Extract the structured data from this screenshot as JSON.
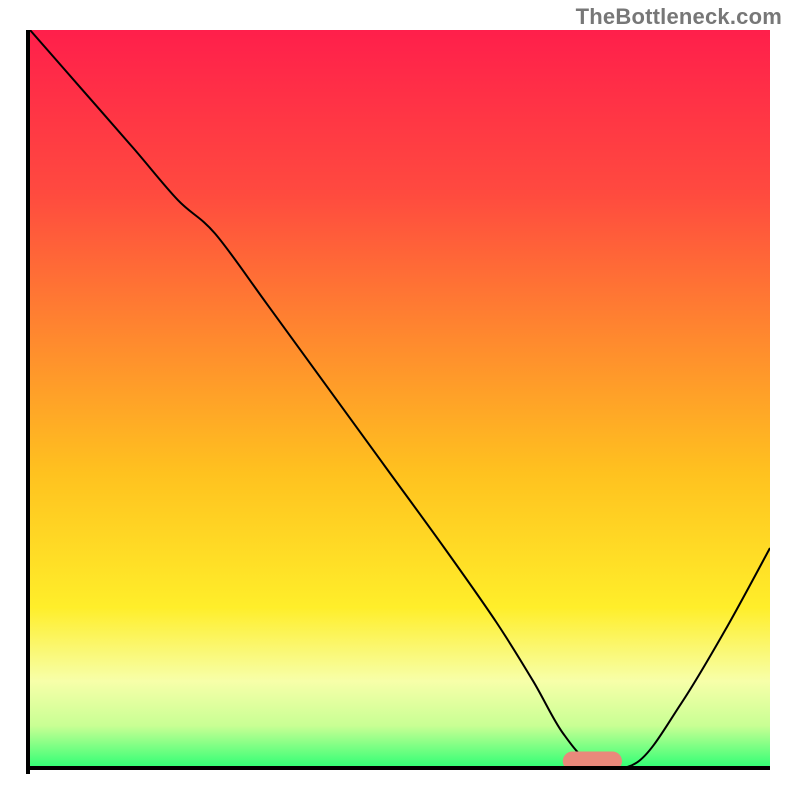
{
  "watermark": "TheBottleneck.com",
  "chart_data": {
    "type": "line",
    "title": "",
    "xlabel": "",
    "ylabel": "",
    "xlim": [
      0,
      100
    ],
    "ylim": [
      0,
      100
    ],
    "grid": false,
    "legend": false,
    "background_gradient_stops": [
      {
        "offset": 0.0,
        "color": "#ff1f4b"
      },
      {
        "offset": 0.22,
        "color": "#ff4a3f"
      },
      {
        "offset": 0.42,
        "color": "#ff8a2e"
      },
      {
        "offset": 0.6,
        "color": "#ffc21f"
      },
      {
        "offset": 0.78,
        "color": "#ffee2a"
      },
      {
        "offset": 0.88,
        "color": "#f7ffa9"
      },
      {
        "offset": 0.94,
        "color": "#c9ff94"
      },
      {
        "offset": 1.0,
        "color": "#27ff73"
      }
    ],
    "series": [
      {
        "name": "bottleneck-curve",
        "color": "#000000",
        "stroke_width": 2.0,
        "x": [
          0,
          7,
          14,
          20,
          25,
          32,
          40,
          48,
          56,
          63,
          68,
          72,
          76,
          82,
          88,
          94,
          100
        ],
        "y": [
          100,
          92,
          84,
          77,
          72.5,
          63,
          52,
          41,
          30,
          20,
          12,
          5,
          1,
          1,
          9,
          19,
          30
        ]
      }
    ],
    "marker": {
      "name": "optimal-region",
      "shape": "capsule",
      "color": "#e9897b",
      "x_center": 76,
      "y_center": 1.2,
      "width": 8,
      "height": 2.6
    }
  }
}
